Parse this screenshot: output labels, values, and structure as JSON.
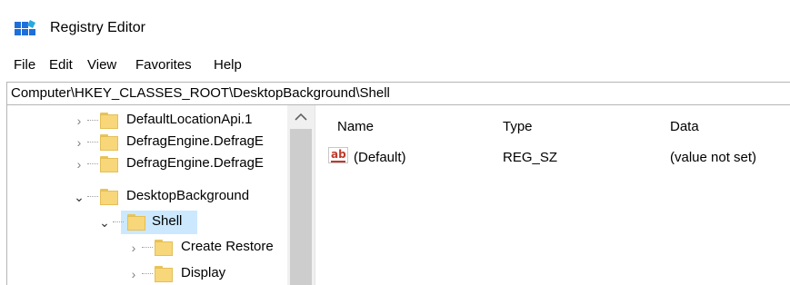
{
  "window": {
    "title": "Registry Editor"
  },
  "menu": [
    "File",
    "Edit",
    "View",
    "Favorites",
    "Help"
  ],
  "address_bar": {
    "path": "Computer\\HKEY_CLASSES_ROOT\\DesktopBackground\\Shell"
  },
  "tree": [
    {
      "label": "DefaultLocationApi.1",
      "expanded": false
    },
    {
      "label": "DefragEngine.DefragE",
      "expanded": false
    },
    {
      "label": "DefragEngine.DefragE",
      "expanded": false
    },
    {
      "label": "DesktopBackground",
      "expanded": true
    },
    {
      "label": "Shell",
      "expanded": true,
      "selected": true
    },
    {
      "label": "Create Restore",
      "expanded": false
    },
    {
      "label": "Display",
      "expanded": false
    }
  ],
  "values_list": {
    "columns": [
      "Name",
      "Type",
      "Data"
    ],
    "rows": [
      {
        "name": "(Default)",
        "type": "REG_SZ",
        "data": "(value not set)",
        "icon": "string-value-icon"
      }
    ]
  },
  "colors": {
    "selection": "#cce8ff",
    "folder": "#f8d77a",
    "scrollbar_thumb": "#cdcdcd"
  }
}
